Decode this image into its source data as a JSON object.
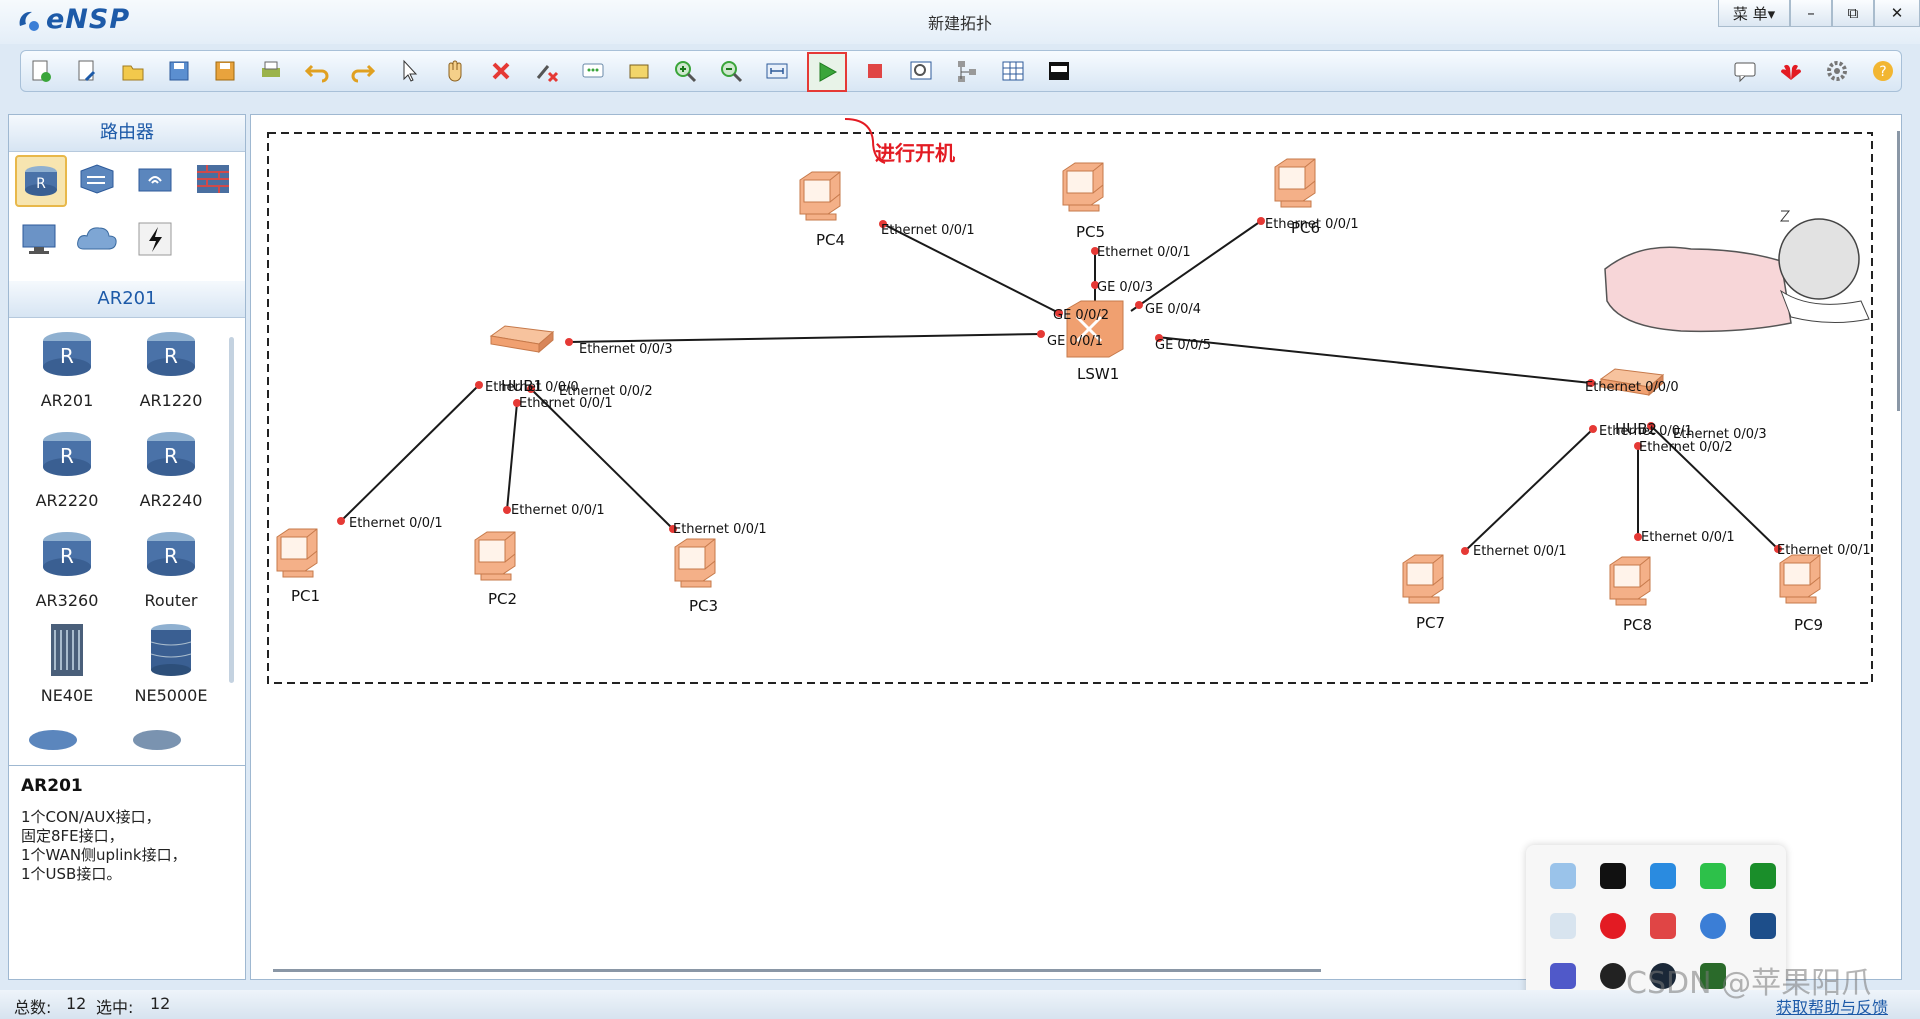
{
  "app": {
    "name": "eNSP",
    "window_title": "新建拓扑",
    "menu_label": "菜 单▾"
  },
  "window_controls": {
    "minimize": "–",
    "restore": "⧉",
    "close": "✕"
  },
  "toolbar": {
    "left_icons": [
      "new-topology-icon",
      "new-example-icon",
      "open-icon",
      "save-icon",
      "save-as-icon",
      "print-icon",
      "undo-icon",
      "redo-icon",
      "select-pointer-icon",
      "pan-hand-icon",
      "delete-icon",
      "delete-link-icon",
      "text-note-icon",
      "rectangle-icon",
      "zoom-in-icon",
      "zoom-out-icon",
      "fit-icon",
      "start-device-icon",
      "stop-device-icon",
      "capture-icon",
      "topology-icon",
      "grid-icon",
      "terminal-icon"
    ],
    "right_icons": [
      "chat-icon",
      "huawei-logo-icon",
      "settings-gear-icon",
      "help-icon"
    ],
    "annotation": "进行开机",
    "colors": {
      "annotation": "#e31b23",
      "start": "#3aa53a",
      "stop": "#e04545"
    }
  },
  "sidebar": {
    "category_title": "路由器",
    "categories": [
      "router-icon",
      "switch-icon",
      "wireless-icon",
      "firewall-icon",
      "pc-terminal-icon",
      "cloud-icon",
      "connection-icon"
    ],
    "device_group_title": "AR201",
    "devices": [
      {
        "name": "AR201",
        "icon": "router-icon"
      },
      {
        "name": "AR1220",
        "icon": "router-icon"
      },
      {
        "name": "AR2220",
        "icon": "router-icon"
      },
      {
        "name": "AR2240",
        "icon": "router-icon"
      },
      {
        "name": "AR3260",
        "icon": "router-icon"
      },
      {
        "name": "Router",
        "icon": "router-icon"
      },
      {
        "name": "NE40E",
        "icon": "chassis-icon"
      },
      {
        "name": "NE5000E",
        "icon": "chassis-icon"
      }
    ],
    "description": {
      "title": "AR201",
      "lines": [
        "1个CON/AUX接口，",
        "固定8FE接口，",
        "1个WAN侧uplink接口，",
        "1个USB接口。"
      ]
    }
  },
  "topology": {
    "nodes": [
      "PC1",
      "PC2",
      "PC3",
      "PC4",
      "PC5",
      "PC6",
      "PC7",
      "PC8",
      "PC9",
      "LSW1",
      "HUB1",
      "HUB2"
    ],
    "port_labels": {
      "pc1": "Ethernet 0/0/1",
      "pc2": "Ethernet 0/0/1",
      "pc3": "Ethernet 0/0/1",
      "pc4": "Ethernet 0/0/1",
      "pc5": "Ethernet 0/0/1",
      "pc6": "Ethernet 0/0/1",
      "pc7": "Ethernet 0/0/1",
      "pc8": "Ethernet 0/0/1",
      "pc9": "Ethernet 0/0/1",
      "hub1_e0": "Ethernet 0/0/0",
      "hub1_e1": "Ethernet 0/0/1",
      "hub1_e2": "Ethernet 0/0/2",
      "hub1_e3": "Ethernet 0/0/3",
      "hub2_e0": "Ethernet 0/0/0",
      "hub2_e1": "Ethernet 0/0/1",
      "hub2_e2": "Ethernet 0/0/2",
      "hub2_e3": "Ethernet 0/0/3",
      "lsw_ge1": "GE 0/0/1",
      "lsw_ge2": "GE 0/0/2",
      "lsw_ge3": "GE 0/0/3",
      "lsw_ge4": "GE 0/0/4",
      "lsw_ge5": "GE 0/0/5"
    },
    "colors": {
      "link": "#1a1a1a",
      "port_dot": "#e53935",
      "device": "#f0a070"
    }
  },
  "status": {
    "total_label": "总数:",
    "total": "12",
    "selected_label": "选中:",
    "selected": "12",
    "help_link": "获取帮助与反馈"
  },
  "watermark": "CSDN @苹果阳爪"
}
